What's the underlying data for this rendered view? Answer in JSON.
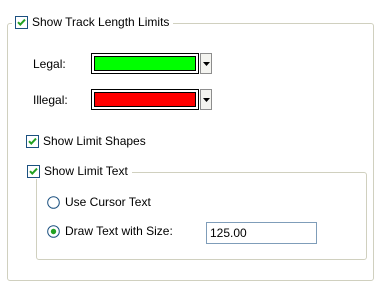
{
  "track_limits": {
    "show_track_length_limits": {
      "label": "Show Track Length Limits",
      "checked": true
    },
    "legal": {
      "label": "Legal:",
      "color": "#00ff00"
    },
    "illegal": {
      "label": "Illegal:",
      "color": "#ff0000"
    },
    "show_limit_shapes": {
      "label": "Show Limit Shapes",
      "checked": true
    },
    "show_limit_text": {
      "label": "Show Limit Text",
      "checked": true,
      "use_cursor_text": {
        "label": "Use Cursor Text",
        "selected": false
      },
      "draw_text_with_size": {
        "label": "Draw Text with Size:",
        "selected": true,
        "value": "125.00"
      }
    }
  },
  "colors": {
    "checkbox_border": "#1c5180",
    "checkmark": "#21a121",
    "groupbox_border": "#d0d0bf",
    "radio_border": "#1c5180",
    "radio_dot": "#21a121",
    "input_border": "#7f9db9"
  },
  "icons": {
    "checkmark": "checkmark-icon",
    "dropdown": "chevron-down-icon",
    "radio_dot": "radio-dot-icon"
  }
}
